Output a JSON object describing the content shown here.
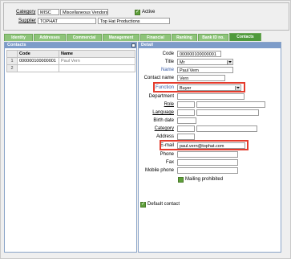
{
  "header": {
    "category_label": "Category",
    "category_code": "MISC",
    "category_name": "Miscellaneous Vendors",
    "active_label": "Active",
    "supplier_label": "Supplier",
    "supplier_code": "TOPHAT",
    "supplier_name": "Top Hat Productions"
  },
  "tabs": [
    "Identity",
    "Addresses",
    "Commercial",
    "Management",
    "Financial",
    "Ranking",
    "Bank ID no.",
    "Contacts"
  ],
  "active_tab": "Contacts",
  "contacts_panel": {
    "title": "Contacts",
    "columns": [
      "Code",
      "Name"
    ],
    "rows": [
      {
        "num": "1",
        "code": "000000100000001",
        "name": "Paul Vern"
      },
      {
        "num": "2",
        "code": "",
        "name": ""
      }
    ]
  },
  "detail_panel": {
    "title": "Detail",
    "code_label": "Code",
    "code": "000000100000001",
    "title_label": "Title",
    "title_value": "Mr",
    "name_label": "Name",
    "name": "Paul Vern",
    "contact_name_label": "Contact name",
    "contact_name": "Vern",
    "function_label": "Function",
    "function": "Buyer",
    "department_label": "Department",
    "role_label": "Role",
    "language_label": "Language",
    "birth_date_label": "Birth date",
    "category_label": "Category",
    "address_label": "Address",
    "email_label": "E-mail",
    "email": "paul.vern@tophat.com",
    "phone_label": "Phone",
    "fax_label": "Fax",
    "mobile_label": "Mobile phone",
    "mailing_label": "Mailing prohibited",
    "default_contact_label": "Default contact"
  },
  "colors": {
    "tab": "#8ec47a",
    "tab_active": "#4f9a3c",
    "panel_title": "#7d9cc9",
    "highlight": "#e43b2c"
  }
}
